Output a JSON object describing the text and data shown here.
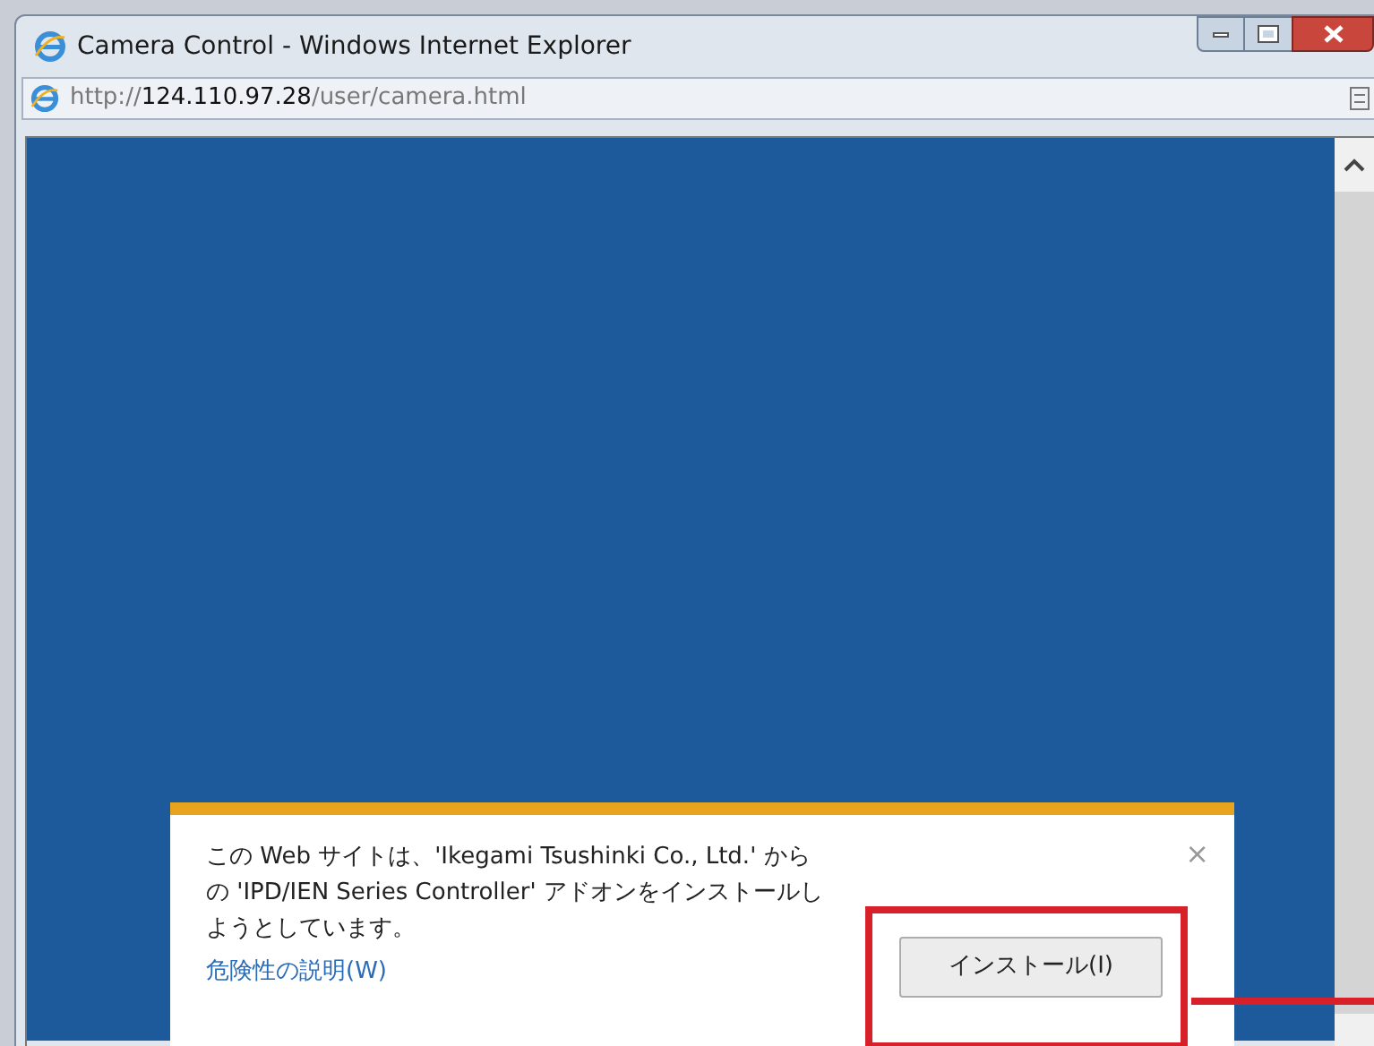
{
  "window": {
    "title": "Camera Control - Windows Internet Explorer"
  },
  "address_bar": {
    "scheme": "http://",
    "host": "124.110.97.28",
    "path": "/user/camera.html"
  },
  "notification": {
    "message": "この Web サイトは、'Ikegami Tsushinki Co., Ltd.' からの 'IPD/IEN Series Controller' アドオンをインストールしようとしています。",
    "link": "危険性の説明(W)",
    "close": "×",
    "button": "インストール(I)"
  }
}
